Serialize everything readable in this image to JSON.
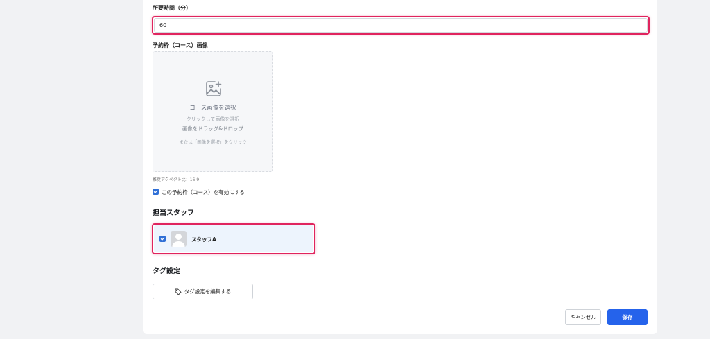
{
  "duration": {
    "label": "所要時間（分）",
    "value": "60"
  },
  "image": {
    "label": "予約枠（コース）画像",
    "dropzone_title": "コース画像を選択",
    "dropzone_sub1": "クリックして画像を選択",
    "dropzone_sub2": "画像をドラッグ&ドロップ",
    "dropzone_sub3": "または「画像を選択」をクリック",
    "aspect_note": "推奨アクペクト比：16:9"
  },
  "enable": {
    "label": "この予約枠（コース）を有効にする",
    "checked": true
  },
  "staff": {
    "title": "担当スタッフ",
    "items": [
      {
        "name": "スタッフA",
        "checked": true
      }
    ]
  },
  "tags": {
    "title": "タグ設定",
    "edit_label": "タグ設定を編集する"
  },
  "actions": {
    "cancel_label": "キャンセル",
    "save_label": "保存"
  },
  "colors": {
    "highlight": "#e0245e",
    "primary": "#2563eb",
    "checkbox": "#2f6fd6",
    "staff_bg": "#edf4fd"
  },
  "icons": {
    "image_add": "image-plus-icon",
    "tag": "tag-icon",
    "check": "check-icon",
    "avatar": "user-avatar-icon"
  }
}
